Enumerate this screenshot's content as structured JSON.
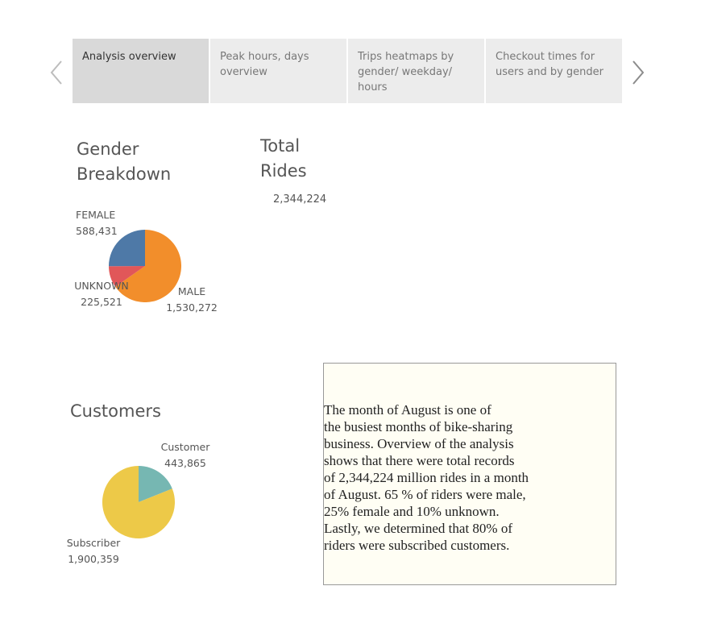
{
  "nav": {
    "tabs": [
      {
        "label": "Analysis overview",
        "active": true
      },
      {
        "label": "Peak hours, days overview",
        "active": false
      },
      {
        "label": "Trips heatmaps by gender/ weekday/ hours",
        "active": false
      },
      {
        "label": "Checkout times for users and by gender",
        "active": false
      }
    ],
    "prev_icon": "chevron-left-icon",
    "next_icon": "chevron-right-icon"
  },
  "gender": {
    "title": "Gender Breakdown",
    "slices": [
      {
        "name": "MALE",
        "value": 1530272,
        "value_label": "1,530,272",
        "color": "#f28e2b"
      },
      {
        "name": "UNKNOWN",
        "value": 225521,
        "value_label": "225,521",
        "color": "#e15759"
      },
      {
        "name": "FEMALE",
        "value": 588431,
        "value_label": "588,431",
        "color": "#4e79a7"
      }
    ]
  },
  "total": {
    "title": "Total Rides",
    "value": "2,344,224"
  },
  "customers": {
    "title": "Customers",
    "slices": [
      {
        "name": "Customer",
        "value": 443865,
        "value_label": "443,865",
        "color": "#76b7b2"
      },
      {
        "name": "Subscriber",
        "value": 1900359,
        "value_label": "1,900,359",
        "color": "#edc948"
      }
    ]
  },
  "summary": {
    "text": "The month of August is one of\n the busiest months of bike-sharing\nbusiness. Overview of the analysis\nshows that there were total records\nof 2,344,224 million rides in a month\nof August. 65 % of riders were male,\n25% female and 10% unknown.\n Lastly, we determined that 80% of\nriders were subscribed customers."
  }
}
